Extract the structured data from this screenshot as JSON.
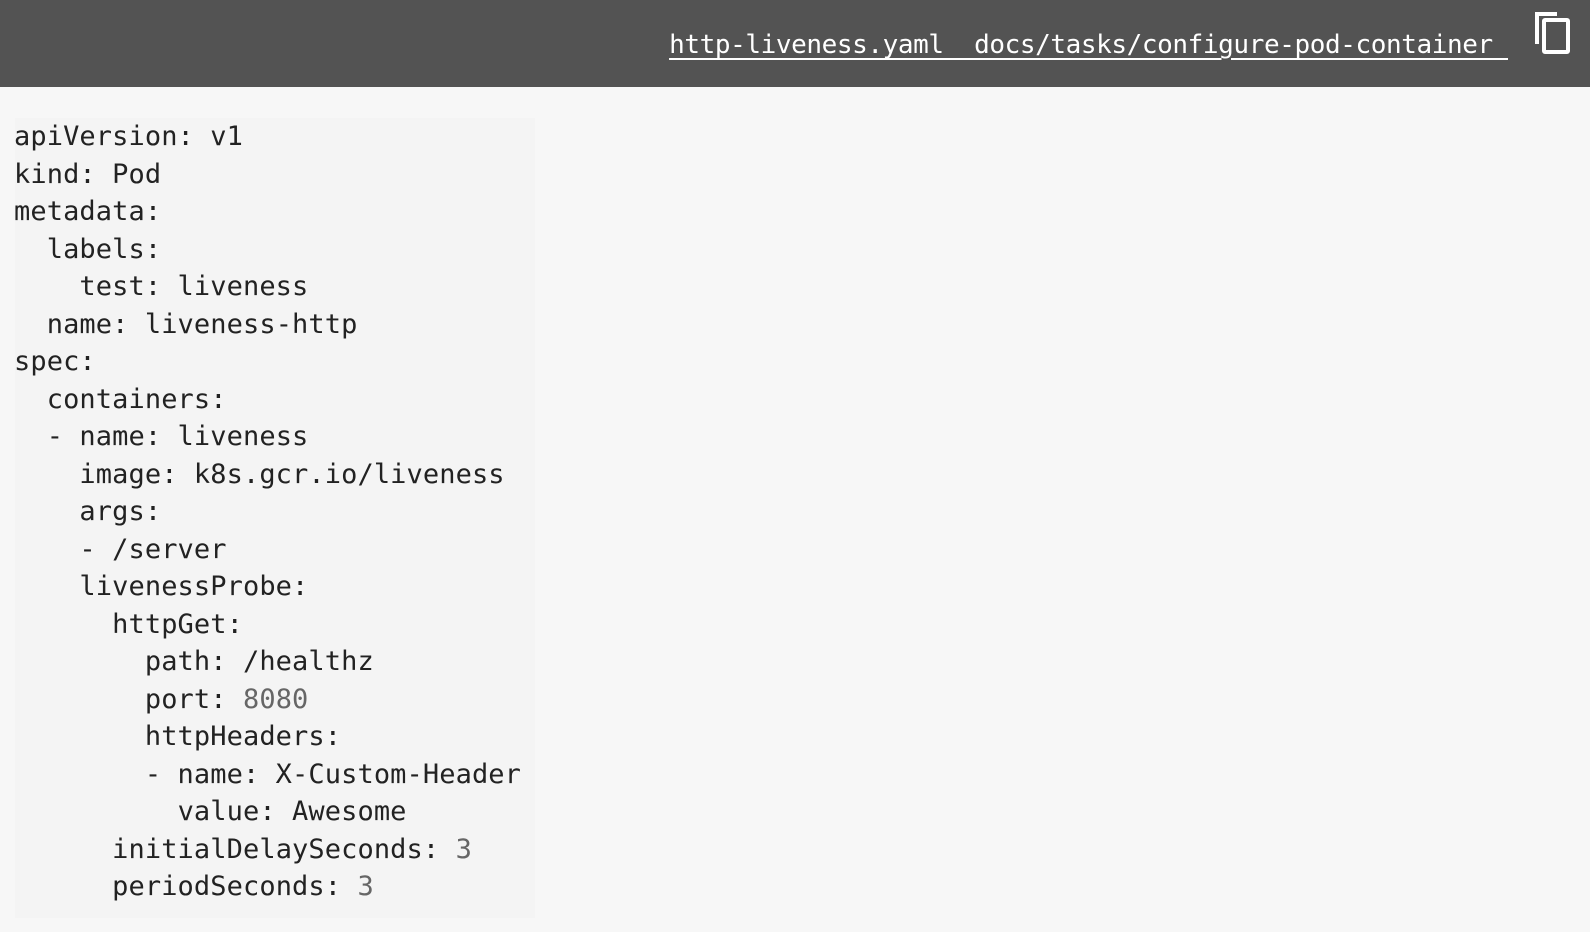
{
  "header": {
    "file_link": "http-liveness.yaml  docs/tasks/configure-pod-container ",
    "copy_icon": "copy-icon"
  },
  "code": {
    "lines": [
      {
        "indent": "",
        "text": "apiVersion: v1",
        "num": ""
      },
      {
        "indent": "",
        "text": "kind: Pod",
        "num": ""
      },
      {
        "indent": "",
        "text": "metadata:",
        "num": ""
      },
      {
        "indent": "  ",
        "text": "labels:",
        "num": ""
      },
      {
        "indent": "    ",
        "text": "test: liveness",
        "num": ""
      },
      {
        "indent": "  ",
        "text": "name: liveness-http",
        "num": ""
      },
      {
        "indent": "",
        "text": "spec:",
        "num": ""
      },
      {
        "indent": "  ",
        "text": "containers:",
        "num": ""
      },
      {
        "indent": "  ",
        "text": "- name: liveness",
        "num": ""
      },
      {
        "indent": "    ",
        "text": "image: k8s.gcr.io/liveness",
        "num": ""
      },
      {
        "indent": "    ",
        "text": "args:",
        "num": ""
      },
      {
        "indent": "    ",
        "text": "- /server",
        "num": ""
      },
      {
        "indent": "    ",
        "text": "livenessProbe:",
        "num": ""
      },
      {
        "indent": "      ",
        "text": "httpGet:",
        "num": ""
      },
      {
        "indent": "        ",
        "text": "path: /healthz",
        "num": ""
      },
      {
        "indent": "        ",
        "text": "port: ",
        "num": "8080"
      },
      {
        "indent": "        ",
        "text": "httpHeaders:",
        "num": ""
      },
      {
        "indent": "        ",
        "text": "- name: X-Custom-Header",
        "num": ""
      },
      {
        "indent": "          ",
        "text": "value: Awesome",
        "num": ""
      },
      {
        "indent": "      ",
        "text": "initialDelaySeconds: ",
        "num": "3"
      },
      {
        "indent": "      ",
        "text": "periodSeconds: ",
        "num": "3"
      }
    ]
  },
  "colors": {
    "header_bg": "#535353",
    "page_bg": "#f7f7f7",
    "code_text": "#222222",
    "number_text": "#666666"
  }
}
